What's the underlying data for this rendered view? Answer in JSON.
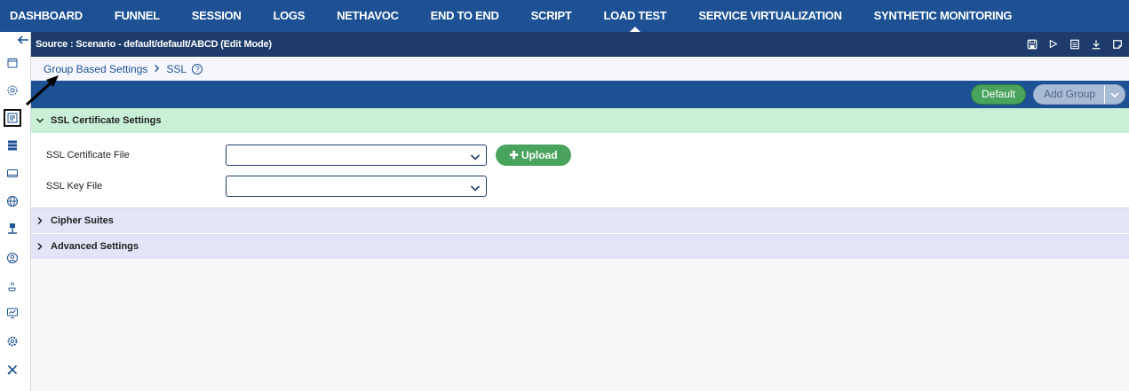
{
  "topnav": {
    "tabs": [
      {
        "label": "DASHBOARD"
      },
      {
        "label": "FUNNEL"
      },
      {
        "label": "SESSION"
      },
      {
        "label": "LOGS"
      },
      {
        "label": "NETHAVOC"
      },
      {
        "label": "END TO END"
      },
      {
        "label": "SCRIPT"
      },
      {
        "label": "LOAD TEST",
        "active": true
      },
      {
        "label": "SERVICE VIRTUALIZATION"
      },
      {
        "label": "SYNTHETIC MONITORING"
      }
    ]
  },
  "source_bar": {
    "title": "Source : Scenario - default/default/ABCD (Edit Mode)",
    "tools": [
      "save-icon",
      "play-icon",
      "document-icon",
      "download-icon",
      "note-icon"
    ]
  },
  "breadcrumb": {
    "parent": "Group Based Settings",
    "current": "SSL",
    "help": "?"
  },
  "actions": {
    "default_label": "Default",
    "add_group_label": "Add Group"
  },
  "sections": {
    "ssl": {
      "title": "SSL Certificate Settings",
      "expanded": true,
      "cert_label": "SSL Certificate File",
      "cert_value": "",
      "key_label": "SSL Key File",
      "key_value": "",
      "upload_label": "Upload"
    },
    "cipher": {
      "title": "Cipher Suites",
      "expanded": false
    },
    "advanced": {
      "title": "Advanced Settings",
      "expanded": false
    }
  },
  "sidebar": {
    "icons": [
      "back-arrow-icon",
      "calendar-icon",
      "eye-gear-icon",
      "scenario-icon",
      "server-list-icon",
      "monitor-icon",
      "globe-icon",
      "network-icon",
      "user-circle-icon",
      "java-icon",
      "chart-monitor-icon",
      "settings-cog-icon",
      "tools-icon"
    ]
  },
  "colors": {
    "nav": "#1d5193",
    "source_bar": "#1d3c6b",
    "ssl_header": "#c9efd6",
    "collapsed_header": "#e3e4f7",
    "green_button": "#4aa35d"
  }
}
